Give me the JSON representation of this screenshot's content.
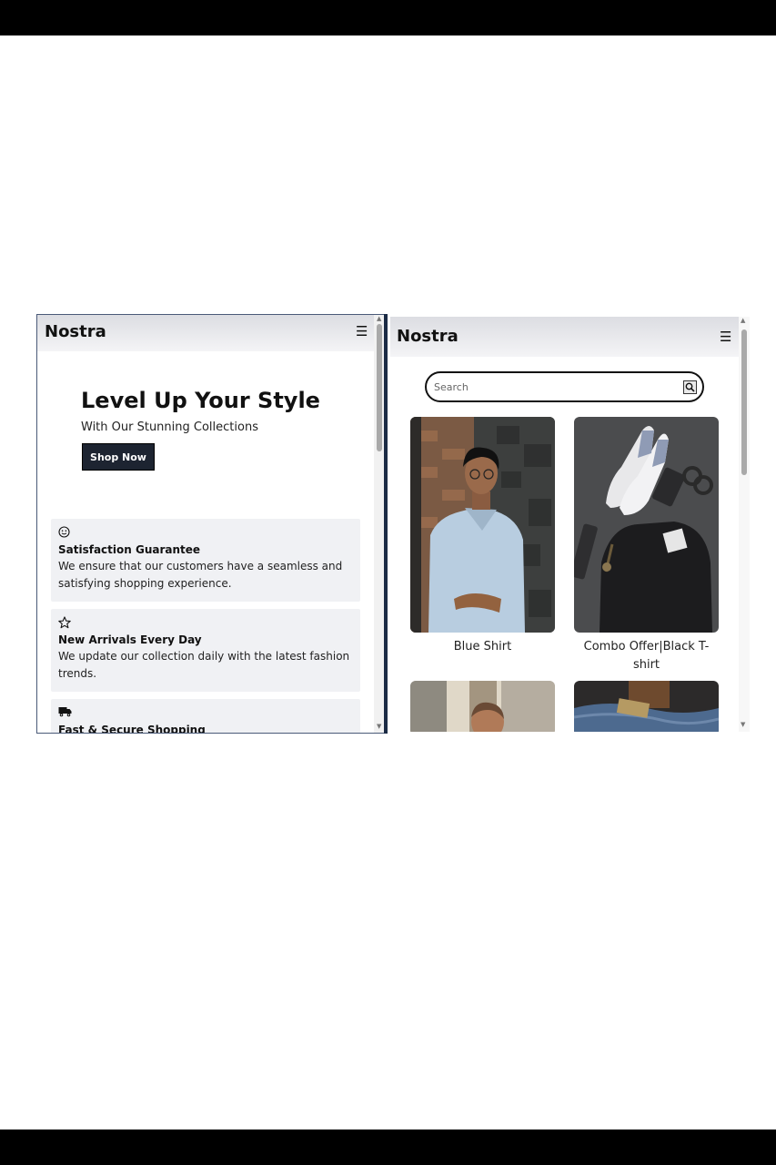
{
  "left_pane": {
    "brand": "Nostra",
    "hero": {
      "title": "Level Up Your Style",
      "subtitle": "With Our Stunning Collections",
      "cta": "Shop Now"
    },
    "features": [
      {
        "icon": "smiley-icon",
        "title": "Satisfaction Guarantee",
        "desc": "We ensure that our customers have a seamless and satisfying shopping experience."
      },
      {
        "icon": "star-icon",
        "title": "New Arrivals Every Day",
        "desc": "We update our collection daily with the latest fashion trends."
      },
      {
        "icon": "truck-icon",
        "title": "Fast & Secure Shopping",
        "desc": ""
      }
    ]
  },
  "right_pane": {
    "brand": "Nostra",
    "search": {
      "placeholder": "Search"
    },
    "products": [
      {
        "name": "Blue Shirt"
      },
      {
        "name": "Combo Offer|Black T-shirt"
      },
      {
        "name": ""
      },
      {
        "name": ""
      }
    ]
  },
  "icons": {
    "menu": "hamburger-icon",
    "search": "search-icon"
  }
}
